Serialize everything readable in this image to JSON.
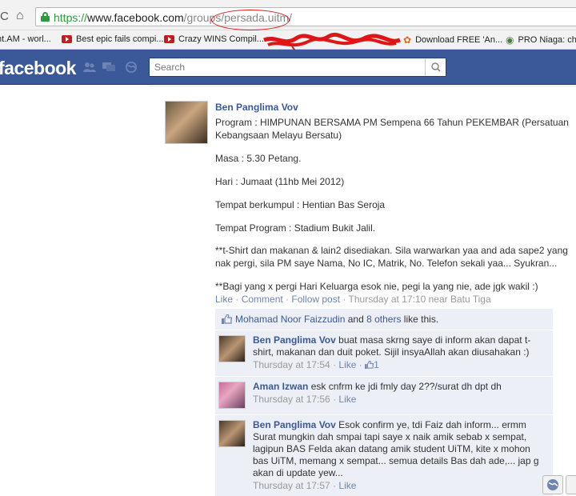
{
  "browser": {
    "back_glyph": "C",
    "home_glyph": "⌂",
    "url_scheme": "https://",
    "url_host": "www.facebook.com",
    "url_path": "/groups/persada.uitm/",
    "bookmarks": [
      {
        "label": "nt.AM - worl...",
        "icon": "none"
      },
      {
        "label": "Best epic fails compi...",
        "icon": "youtube-icon"
      },
      {
        "label": "Crazy WINS Compil...",
        "icon": "youtube-icon"
      },
      {
        "label": "Download FREE 'An...",
        "icon": "swirl-icon"
      },
      {
        "label": "PRO Niaga: cha",
        "icon": "globe-icon"
      }
    ]
  },
  "facebook": {
    "logo": "facebook",
    "search_placeholder": "Search"
  },
  "post": {
    "author": "Ben Panglima Vov",
    "lines": [
      "Program : HIMPUNAN BERSAMA PM Sempena 66 Tahun PEKEMBAR (Persatuan Kebangsaan Melayu Bersatu)",
      "Masa : 5.30 Petang.",
      "Hari : Jumaat (11hb Mei 2012)",
      "Tempat berkumpul : Hentian Bas Seroja",
      "Tempat Program : Stadium Bukit Jalil.",
      "**t-Shirt dan makanan & lain2 disediakan. Sila warwarkan yaa and ada sape2 yang nak pergi, sila PM saye Nama, No IC, Matrik, No. Telefon sekali yaa... Syukran...",
      "**Bagi yang x pergi Hari Keluarga esok nie, pegi la yang nie, ade jgk wakil :)"
    ],
    "actions": {
      "like": "Like",
      "comment": "Comment",
      "follow": "Follow post",
      "sep": " · ",
      "time": "Thursday at 17:10 near Batu Tiga"
    },
    "likes": {
      "name": "Mohamad Noor Faizzudin",
      "and": " and ",
      "others": "8 others",
      "suffix": " like this."
    }
  },
  "comments": [
    {
      "author": "Ben Panglima Vov",
      "text": "buat masa skrng saye di inform akan dapat t-shirt, makanan dan duit poket. Sijil insyaAllah akan diusahakan :)",
      "time": "Thursday at 17:54",
      "like": "Like",
      "like_count": "1"
    },
    {
      "author": "Aman Izwan",
      "text": "esk cnfrm ke jdi fmly day 2??/surat dh dpt dh",
      "time": "Thursday at 17:56",
      "like": "Like"
    },
    {
      "author": "Ben Panglima Vov",
      "text": "Esok confirm ye, tdi Faiz dah inform... ermm Surat mungkin dah smpai tapi saye x naik amik sebab x sempat, lagipun BAS Felda akan datang amik student UiTM, kite x mohon bas UiTM, memang x sempat... semua details Bas dah ade,... jap g akan di update yew...",
      "time": "Thursday at 17:57",
      "like": "Like"
    }
  ],
  "colors": {
    "fb_blue": "#3b5998",
    "link": "#6d84b4",
    "secure_green": "#2f9a3a",
    "annotation_red": "#e01515"
  }
}
